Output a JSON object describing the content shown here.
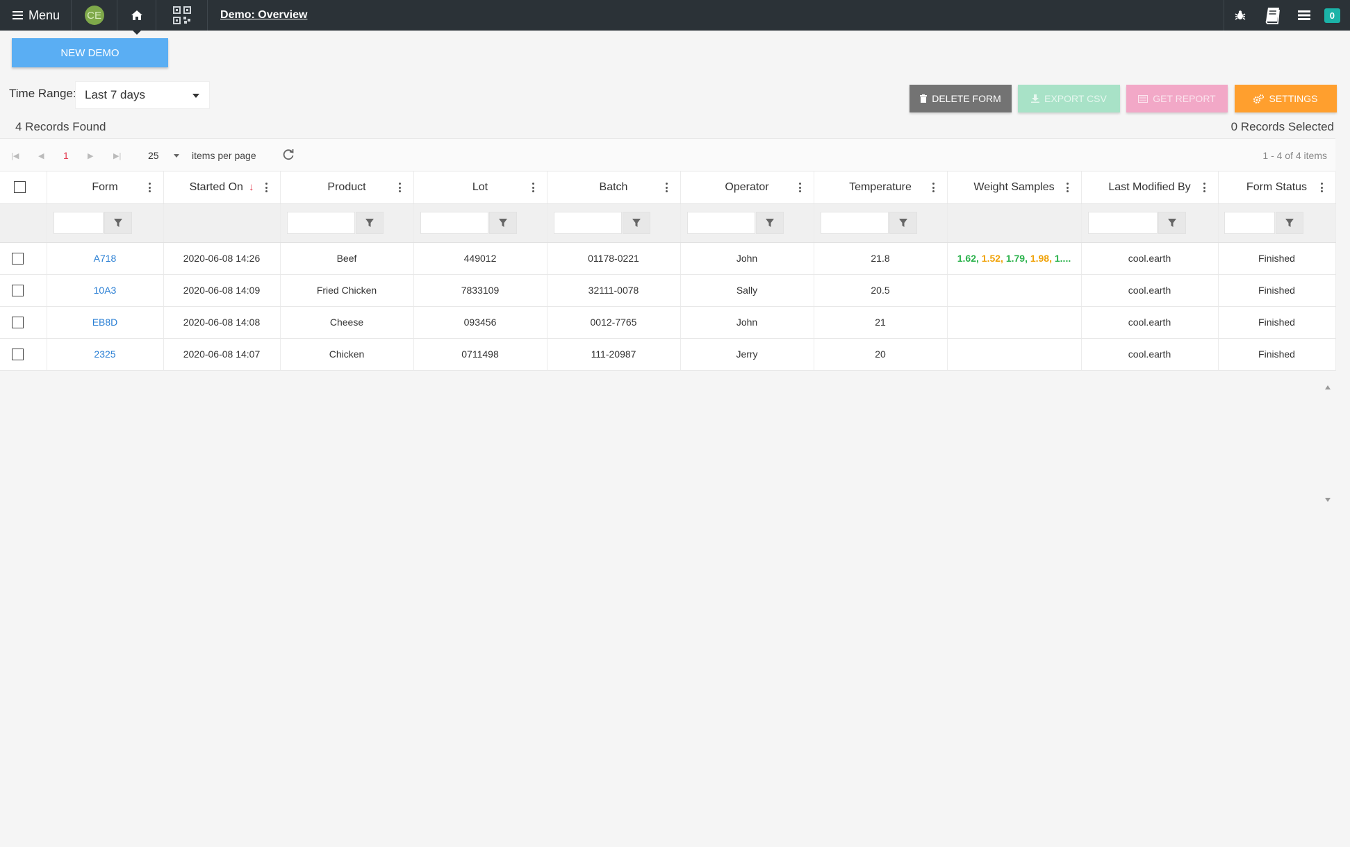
{
  "nav": {
    "menu_label": "Menu",
    "avatar_initials": "CE",
    "breadcrumb": "Demo: Overview",
    "notification_count": "0"
  },
  "actions": {
    "new_demo": "NEW DEMO",
    "delete_form": "DELETE FORM",
    "export_csv": "EXPORT CSV",
    "get_report": "GET REPORT",
    "settings": "SETTINGS"
  },
  "filters": {
    "time_range_label": "Time Range:",
    "time_range_value": "Last 7 days"
  },
  "summary": {
    "records_found": "4 Records Found",
    "records_selected": "0 Records Selected"
  },
  "pager": {
    "current_page": "1",
    "page_size": "25",
    "items_per_page_label": "items per page",
    "range_info": "1 - 4 of 4 items"
  },
  "columns": [
    "Form",
    "Started On",
    "Product",
    "Lot",
    "Batch",
    "Operator",
    "Temperature",
    "Weight Samples",
    "Last Modified By",
    "Form Status"
  ],
  "rows": [
    {
      "form": "A718",
      "started_on": "2020-06-08 14:26",
      "product": "Beef",
      "lot": "449012",
      "batch": "01178-0221",
      "operator": "John",
      "temperature": "21.8",
      "weights": [
        "1.62",
        "1.52",
        "1.79",
        "1.98",
        "1...."
      ],
      "modified_by": "cool.earth",
      "status": "Finished"
    },
    {
      "form": "10A3",
      "started_on": "2020-06-08 14:09",
      "product": "Fried Chicken",
      "lot": "7833109",
      "batch": "32111-0078",
      "operator": "Sally",
      "temperature": "20.5",
      "weights": [],
      "modified_by": "cool.earth",
      "status": "Finished"
    },
    {
      "form": "EB8D",
      "started_on": "2020-06-08 14:08",
      "product": "Cheese",
      "lot": "093456",
      "batch": "0012-7765",
      "operator": "John",
      "temperature": "21",
      "weights": [],
      "modified_by": "cool.earth",
      "status": "Finished"
    },
    {
      "form": "2325",
      "started_on": "2020-06-08 14:07",
      "product": "Chicken",
      "lot": "0711498",
      "batch": "111-20987",
      "operator": "Jerry",
      "temperature": "20",
      "weights": [],
      "modified_by": "cool.earth",
      "status": "Finished"
    }
  ],
  "colors": {
    "topbar": "#2b3237",
    "new_demo": "#5aaef3",
    "delete": "#737373",
    "export": "#a8e2c7",
    "report": "#f2a8c7",
    "settings": "#ff9f2e",
    "link": "#2a7fd4",
    "weight_green": "#2bb24c",
    "weight_orange": "#f0a30a"
  }
}
